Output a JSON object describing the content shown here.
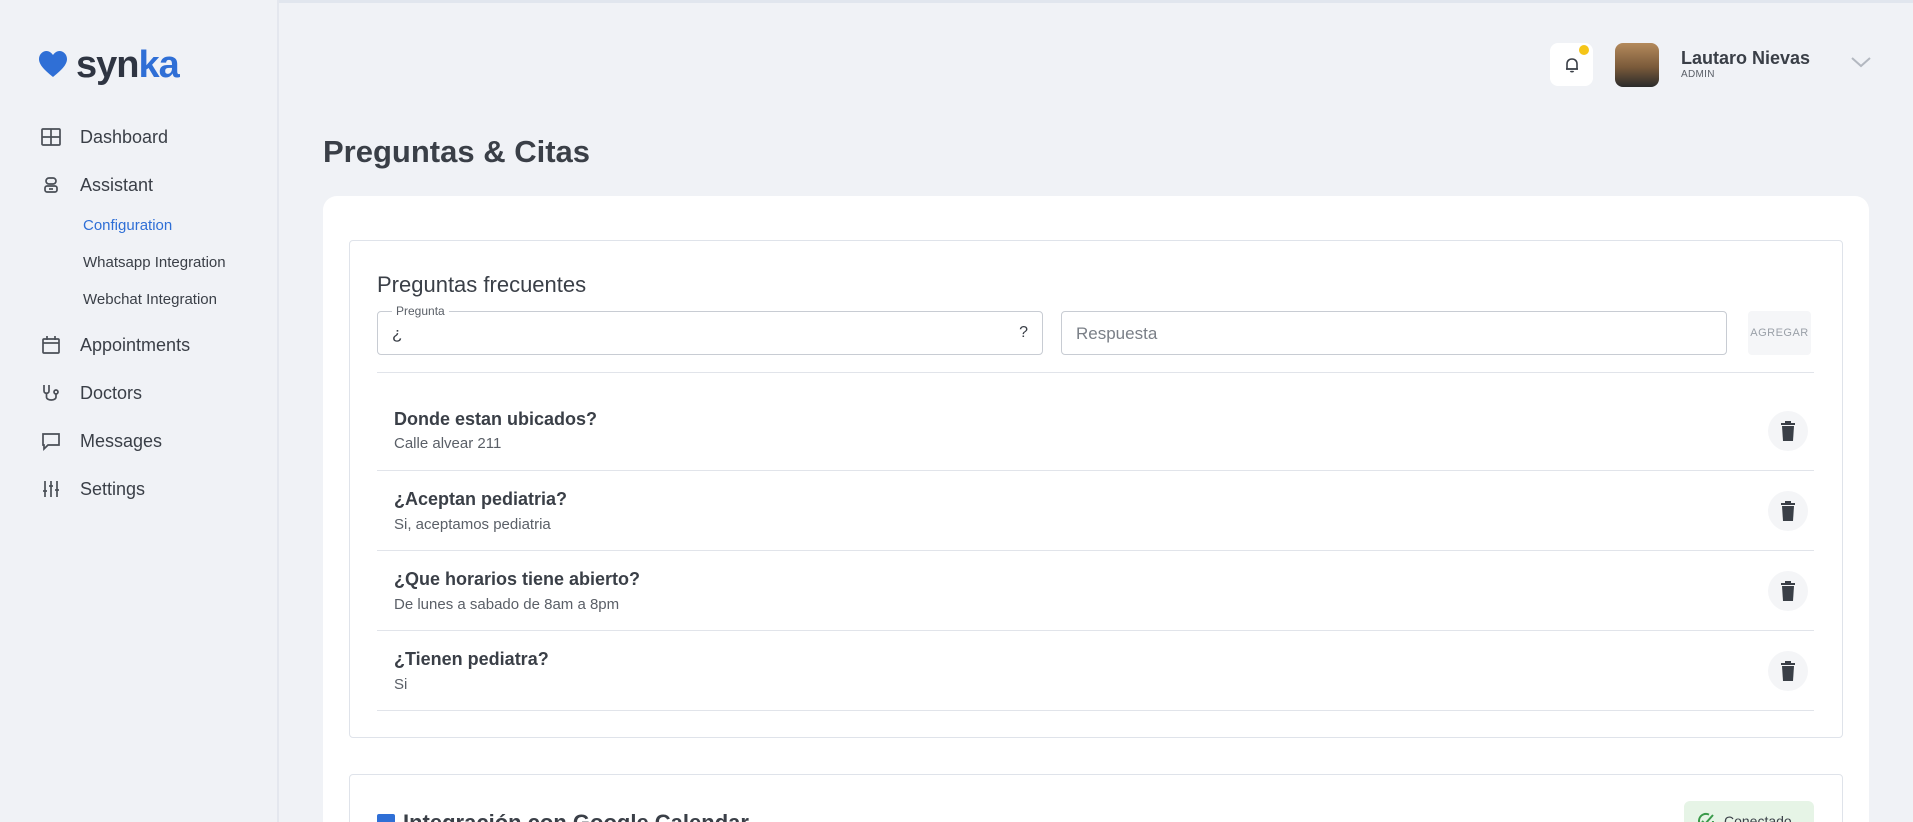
{
  "brand": {
    "part1": "syn",
    "part2": "ka",
    "accent": "#2f6fd6"
  },
  "sidebar": {
    "items": [
      {
        "label": "Dashboard",
        "icon": "grid-icon"
      },
      {
        "label": "Assistant",
        "icon": "robot-icon"
      },
      {
        "label": "Appointments",
        "icon": "calendar-icon"
      },
      {
        "label": "Doctors",
        "icon": "stethoscope-icon"
      },
      {
        "label": "Messages",
        "icon": "message-icon"
      },
      {
        "label": "Settings",
        "icon": "sliders-icon"
      }
    ],
    "subitems": [
      {
        "label": "Configuration",
        "active": true
      },
      {
        "label": "Whatsapp Integration",
        "active": false
      },
      {
        "label": "Webchat Integration",
        "active": false
      }
    ]
  },
  "header": {
    "user_name": "Lautaro Nievas",
    "user_role": "ADMIN",
    "notification_dot_color": "#f5c518"
  },
  "page": {
    "title": "Preguntas & Citas"
  },
  "faq": {
    "title": "Preguntas frecuentes",
    "question_legend": "Pregunta",
    "question_value": "¿",
    "question_suffix": "?",
    "answer_placeholder": "Respuesta",
    "add_label": "AGREGAR",
    "items": [
      {
        "question": "Donde estan ubicados?",
        "answer": "Calle alvear 211"
      },
      {
        "question": "¿Aceptan pediatria?",
        "answer": "Si, aceptamos pediatria"
      },
      {
        "question": "¿Que horarios tiene abierto?",
        "answer": "De lunes a sabado de 8am a 8pm"
      },
      {
        "question": "¿Tienen pediatra?",
        "answer": "Si"
      }
    ]
  },
  "calendar": {
    "title": "Integración con Google Calendar",
    "status": "Conectado",
    "status_color": "#3a9a4a"
  }
}
